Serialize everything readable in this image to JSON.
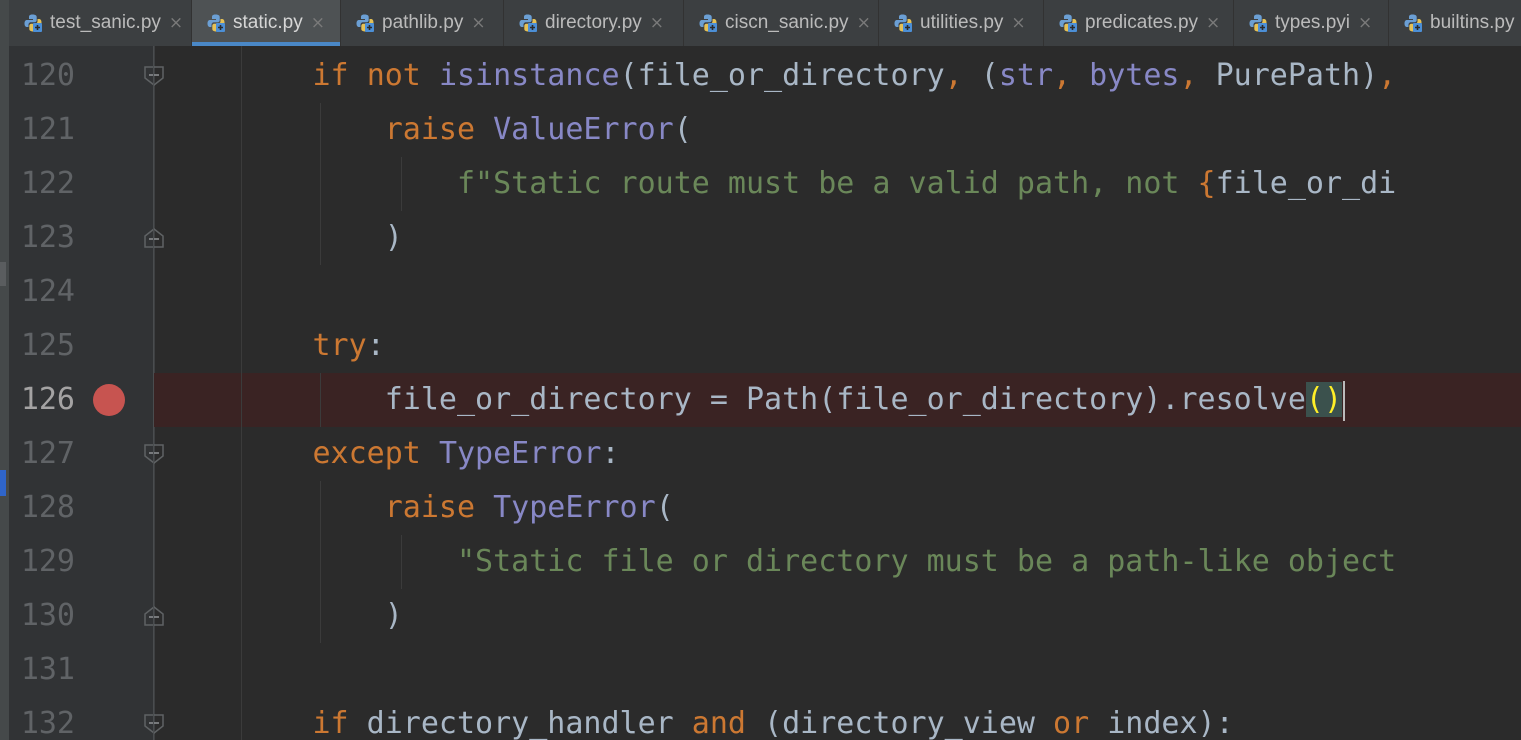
{
  "tabs": [
    {
      "label": "test_sanic.py",
      "active": false
    },
    {
      "label": "static.py",
      "active": true
    },
    {
      "label": "pathlib.py",
      "active": false
    },
    {
      "label": "directory.py",
      "active": false
    },
    {
      "label": "ciscn_sanic.py",
      "active": false
    },
    {
      "label": "utilities.py",
      "active": false
    },
    {
      "label": "predicates.py",
      "active": false
    },
    {
      "label": "types.pyi",
      "active": false
    },
    {
      "label": "builtins.py",
      "active": false
    }
  ],
  "tab_icon": "python-file-icon",
  "close_icon": "close-icon",
  "close_glyph": "×",
  "colors": {
    "keyword": "#cc7832",
    "builtin": "#8888c6",
    "string": "#6a8759",
    "identifier": "#a9b7c6",
    "breakpoint": "#c75450",
    "active_tab_underline": "#4a88c7"
  },
  "editor": {
    "breakpoint_line": "126",
    "lines": [
      {
        "num": "120",
        "tokens": [
          {
            "t": "        "
          },
          {
            "t": "if",
            "c": "kw"
          },
          {
            "t": " "
          },
          {
            "t": "not",
            "c": "kw"
          },
          {
            "t": " "
          },
          {
            "t": "isinstance",
            "c": "bi"
          },
          {
            "t": "(file_or_directory"
          },
          {
            "t": ",",
            "c": "kw"
          },
          {
            "t": " ("
          },
          {
            "t": "str",
            "c": "bi"
          },
          {
            "t": ",",
            "c": "kw"
          },
          {
            "t": " "
          },
          {
            "t": "bytes",
            "c": "bi"
          },
          {
            "t": ",",
            "c": "kw"
          },
          {
            "t": " PurePath)"
          },
          {
            "t": ",",
            "c": "kw"
          }
        ]
      },
      {
        "num": "121",
        "tokens": [
          {
            "t": "            "
          },
          {
            "t": "raise",
            "c": "kw"
          },
          {
            "t": " "
          },
          {
            "t": "ValueError",
            "c": "bi"
          },
          {
            "t": "("
          }
        ]
      },
      {
        "num": "122",
        "tokens": [
          {
            "t": "                "
          },
          {
            "t": "f\"Static route must be a valid path, not ",
            "c": "str"
          },
          {
            "t": "{",
            "c": "brace"
          },
          {
            "t": "file_or_di"
          }
        ]
      },
      {
        "num": "123",
        "tokens": [
          {
            "t": "            )"
          }
        ]
      },
      {
        "num": "124",
        "tokens": []
      },
      {
        "num": "125",
        "tokens": [
          {
            "t": "        "
          },
          {
            "t": "try",
            "c": "kw"
          },
          {
            "t": ":"
          }
        ]
      },
      {
        "num": "126",
        "tokens": [
          {
            "t": "            file_or_directory = Path(file_or_directory).resolve"
          },
          {
            "t": "()",
            "c": "paren-hl"
          }
        ]
      },
      {
        "num": "127",
        "tokens": [
          {
            "t": "        "
          },
          {
            "t": "except",
            "c": "kw"
          },
          {
            "t": " "
          },
          {
            "t": "TypeError",
            "c": "bi"
          },
          {
            "t": ":"
          }
        ]
      },
      {
        "num": "128",
        "tokens": [
          {
            "t": "            "
          },
          {
            "t": "raise",
            "c": "kw"
          },
          {
            "t": " "
          },
          {
            "t": "TypeError",
            "c": "bi"
          },
          {
            "t": "("
          }
        ]
      },
      {
        "num": "129",
        "tokens": [
          {
            "t": "                "
          },
          {
            "t": "\"Static file or directory must be a path-like object",
            "c": "str"
          }
        ]
      },
      {
        "num": "130",
        "tokens": [
          {
            "t": "            )"
          }
        ]
      },
      {
        "num": "131",
        "tokens": []
      },
      {
        "num": "132",
        "tokens": [
          {
            "t": "        "
          },
          {
            "t": "if",
            "c": "kw"
          },
          {
            "t": " directory_handler "
          },
          {
            "t": "and",
            "c": "kw"
          },
          {
            "t": " (directory_view "
          },
          {
            "t": "or",
            "c": "kw"
          },
          {
            "t": " index):"
          }
        ]
      }
    ]
  }
}
